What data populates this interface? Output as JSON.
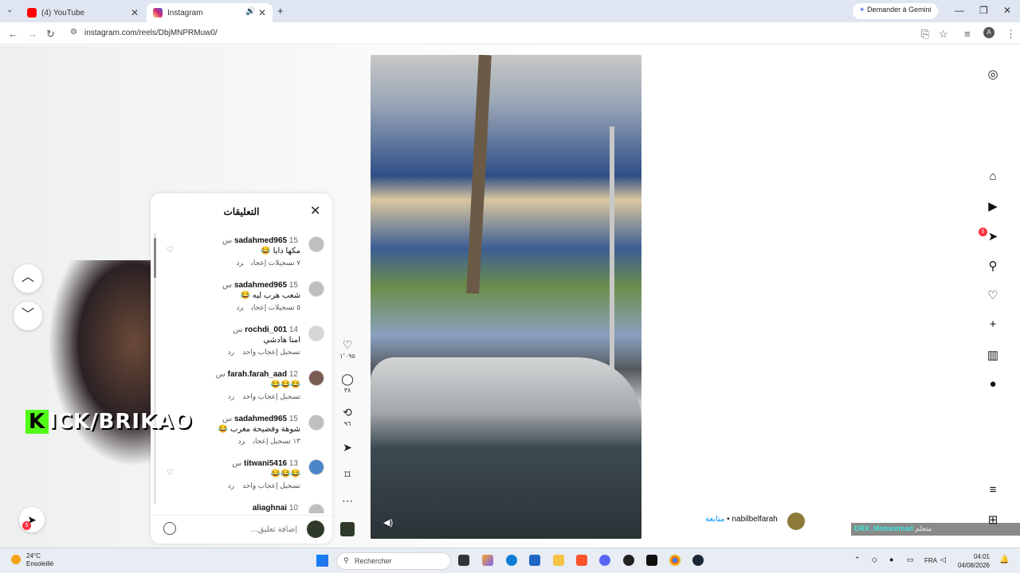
{
  "browser": {
    "tabs": [
      {
        "title": "(4) YouTube",
        "favicon": "youtube-icon",
        "color": "#ff0000",
        "active": false
      },
      {
        "title": "Instagram",
        "favicon": "instagram-icon",
        "color": "#d62976",
        "active": true
      }
    ],
    "gemini_label": "Demander à Gemini",
    "url": "instagram.com/reels/DbjMNPRMuw0/",
    "profile_initial": "A"
  },
  "comments_panel": {
    "title": "التعليقات",
    "input_placeholder": "إضافة تعليق...",
    "items": [
      {
        "user": "sadahmed965",
        "time": "15 س",
        "text": "مكها دابا 😂",
        "likes": "٧ تسجيلات إعجاب",
        "reply": "رد"
      },
      {
        "user": "sadahmed965",
        "time": "15 س",
        "text": "شعب هرب ليه 😂",
        "likes": "٥ تسجيلات إعجاب",
        "reply": "رد"
      },
      {
        "user": "rochdi_001",
        "time": "14 س",
        "text": "امنا هادشي",
        "likes": "تسجيل إعجاب واحد",
        "reply": "رد"
      },
      {
        "user": "farah.farah_aad",
        "time": "12 س",
        "text": "😂😂😂",
        "likes": "تسجيل إعجاب واحد",
        "reply": "رد"
      },
      {
        "user": "sadahmed965",
        "time": "15 س",
        "text": "شوهة وفضيحة مغرب 😂",
        "likes": "١٣ تسجيل إعجاب",
        "reply": "رد"
      },
      {
        "user": "titwani5416",
        "time": "13 س",
        "text": "😂😂😂",
        "likes": "تسجيل إعجاب واحد",
        "reply": "رد"
      },
      {
        "user": "aliaghnai",
        "time": "10",
        "text": "",
        "likes": "",
        "reply": ""
      }
    ]
  },
  "reel_actions": {
    "likes_count": "١٬٠٩٥",
    "comments_count": "٣٨",
    "reposts_count": "٩٦"
  },
  "reel_author": {
    "username": "nabilbelfarah",
    "follow_label": "متابعة"
  },
  "overlay": {
    "kick_k": "K",
    "kick_rest": "ICK/BRIKAO",
    "chat_name": "DRX_Mohammad",
    "chat_text": "متعلم"
  },
  "right_nav": {
    "messages_badge": "5"
  },
  "bottom_messages_badge": "5",
  "taskbar": {
    "temp": "24°C",
    "weather": "Ensoleillé",
    "search_placeholder": "Rechercher",
    "lang": "FRA",
    "time": "04:01",
    "date": "04/08/2026"
  }
}
